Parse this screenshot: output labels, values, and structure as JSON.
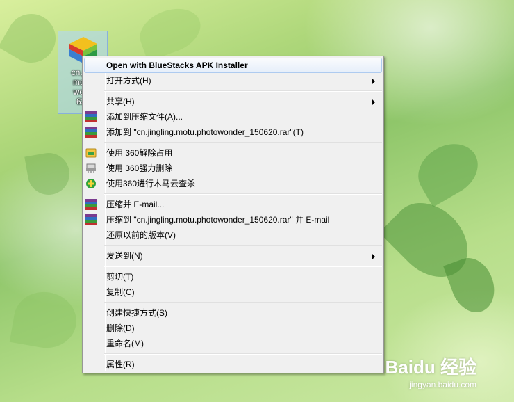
{
  "desktop": {
    "file_icon": {
      "caption_lines": [
        "cn.jing",
        "motu.",
        "wond",
        "620"
      ],
      "icon_name": "bluestacks-app-icon"
    }
  },
  "context_menu": {
    "items": [
      {
        "label": "Open with BlueStacks APK Installer",
        "bold": true,
        "icon": null,
        "submenu": false
      },
      {
        "label": "打开方式(H)",
        "icon": null,
        "submenu": true
      },
      {
        "label": "共享(H)",
        "icon": null,
        "submenu": true
      },
      {
        "label": "添加到压缩文件(A)...",
        "icon": "winrar-icon",
        "submenu": false
      },
      {
        "label": "添加到 \"cn.jingling.motu.photowonder_150620.rar\"(T)",
        "icon": "winrar-icon",
        "submenu": false
      },
      {
        "label": "使用 360解除占用",
        "icon": "unlock-360-icon",
        "submenu": false
      },
      {
        "label": "使用 360强力删除",
        "icon": "shredder-360-icon",
        "submenu": false
      },
      {
        "label": "使用360进行木马云查杀",
        "icon": "antivirus-360-icon",
        "submenu": false
      },
      {
        "label": "压缩并 E-mail...",
        "icon": "winrar-icon",
        "submenu": false
      },
      {
        "label": "压缩到 \"cn.jingling.motu.photowonder_150620.rar\" 并 E-mail",
        "icon": "winrar-icon",
        "submenu": false
      },
      {
        "label": "还原以前的版本(V)",
        "icon": null,
        "submenu": false
      },
      {
        "label": "发送到(N)",
        "icon": null,
        "submenu": true
      },
      {
        "label": "剪切(T)",
        "icon": null,
        "submenu": false
      },
      {
        "label": "复制(C)",
        "icon": null,
        "submenu": false
      },
      {
        "label": "创建快捷方式(S)",
        "icon": null,
        "submenu": false
      },
      {
        "label": "删除(D)",
        "icon": null,
        "submenu": false
      },
      {
        "label": "重命名(M)",
        "icon": null,
        "submenu": false
      },
      {
        "label": "属性(R)",
        "icon": null,
        "submenu": false
      }
    ]
  },
  "watermark": {
    "logo": "Baidu 经验",
    "url": "jingyan.baidu.com"
  },
  "colors": {
    "menu_bg": "#f0f0f0",
    "highlight_border": "#aecbf0",
    "winrar_stack": [
      "#7a3b8f",
      "#2f6fbf",
      "#3b9a3b",
      "#c03030"
    ]
  }
}
